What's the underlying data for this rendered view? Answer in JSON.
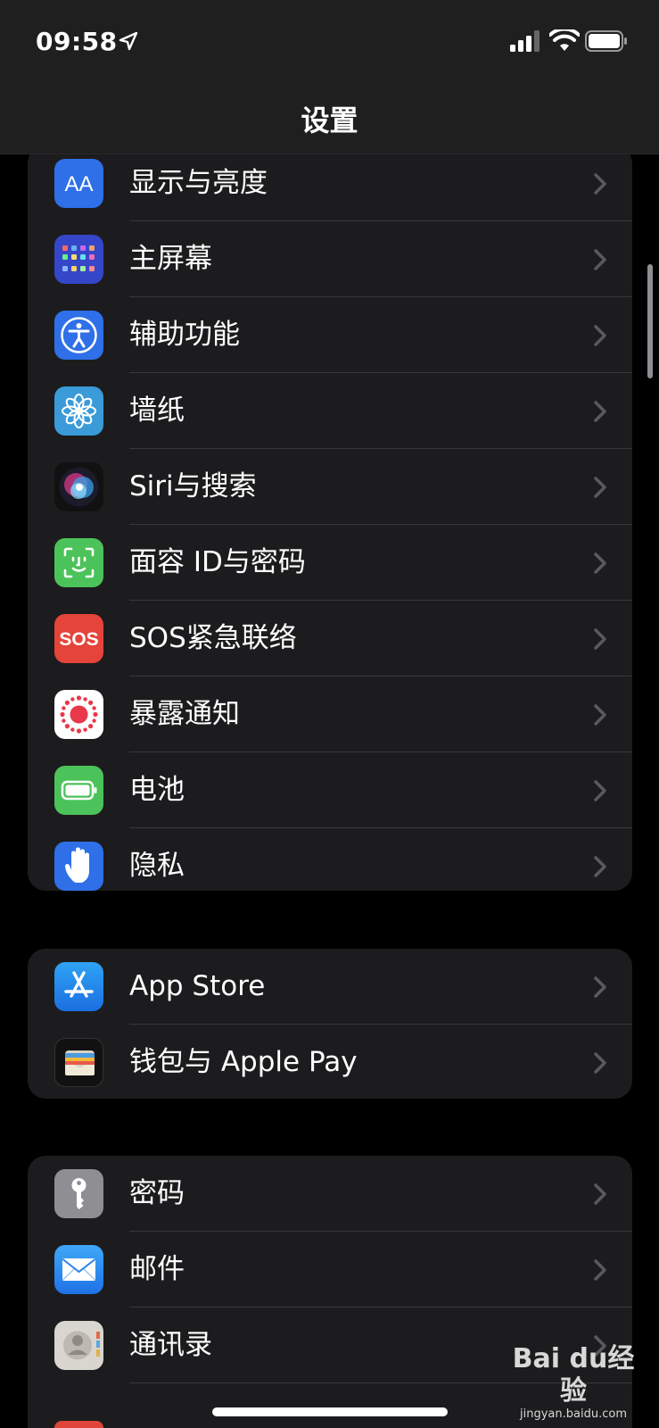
{
  "status_bar": {
    "time": "09:58"
  },
  "nav": {
    "title": "设置"
  },
  "groups": [
    {
      "items": [
        {
          "label": "显示与亮度",
          "icon": "display-brightness-icon"
        },
        {
          "label": "主屏幕",
          "icon": "home-screen-icon"
        },
        {
          "label": "辅助功能",
          "icon": "accessibility-icon"
        },
        {
          "label": "墙纸",
          "icon": "wallpaper-icon"
        },
        {
          "label": "Siri与搜索",
          "icon": "siri-icon"
        },
        {
          "label": "面容 ID与密码",
          "icon": "face-id-icon"
        },
        {
          "label": "SOS紧急联络",
          "icon": "sos-icon",
          "icon_text": "SOS"
        },
        {
          "label": "暴露通知",
          "icon": "exposure-notification-icon"
        },
        {
          "label": "电池",
          "icon": "battery-setting-icon"
        },
        {
          "label": "隐私",
          "icon": "privacy-hand-icon"
        }
      ]
    },
    {
      "items": [
        {
          "label": "App Store",
          "icon": "app-store-icon"
        },
        {
          "label": "钱包与 Apple Pay",
          "icon": "wallet-icon"
        }
      ]
    },
    {
      "items": [
        {
          "label": "密码",
          "icon": "passwords-key-icon"
        },
        {
          "label": "邮件",
          "icon": "mail-icon"
        },
        {
          "label": "通讯录",
          "icon": "contacts-icon"
        }
      ]
    }
  ],
  "watermark": {
    "brand": "Bai du经验",
    "url": "jingyan.baidu.com"
  },
  "colors": {
    "background": "#000000",
    "group_bg": "#1c1c1e",
    "separator": "#38383a",
    "chevron": "#5a5a5e"
  }
}
